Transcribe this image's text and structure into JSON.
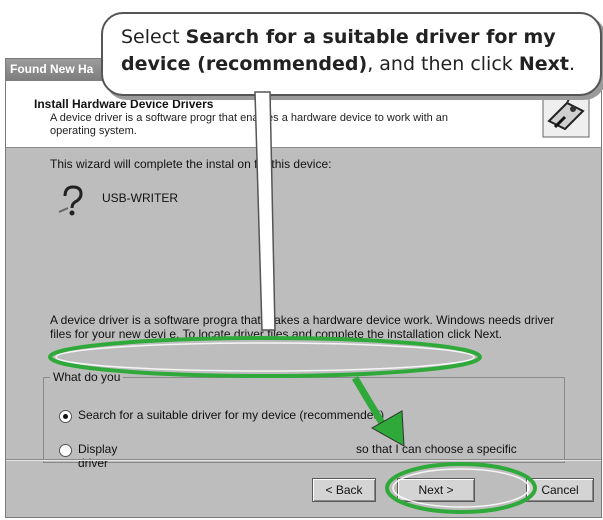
{
  "window": {
    "title": "Found New Ha"
  },
  "header": {
    "title": "Install Hardware Device Drivers",
    "description": "A device driver is a software progr   that enables a hardware device to work with an operating system."
  },
  "content": {
    "intro": "This wizard will complete the instal    on for this device:",
    "device_name": "USB-WRITER",
    "paragraph": "A device driver is a software progra   that makes a hardware device work. Windows needs driver files for your new devi   e. To locate driver files and complete the installation click Next.",
    "question": "What do you",
    "options": [
      {
        "label": "Search for a suitable driver for my device (recommended)",
        "selected": true
      },
      {
        "label": "Display",
        "label_tail": "so that I can choose a specific",
        "label_line2": "driver",
        "selected": false
      }
    ]
  },
  "buttons": {
    "back": "< Back",
    "next": "Next >",
    "cancel": "Cancel"
  },
  "callout": {
    "prefix": "Select ",
    "bold1": "Search for a suitable driver for my device (recommended)",
    "middle": ", and then click ",
    "bold2": "Next",
    "suffix": "."
  },
  "colors": {
    "highlight": "#2faa3a",
    "callout_border": "#555555"
  }
}
